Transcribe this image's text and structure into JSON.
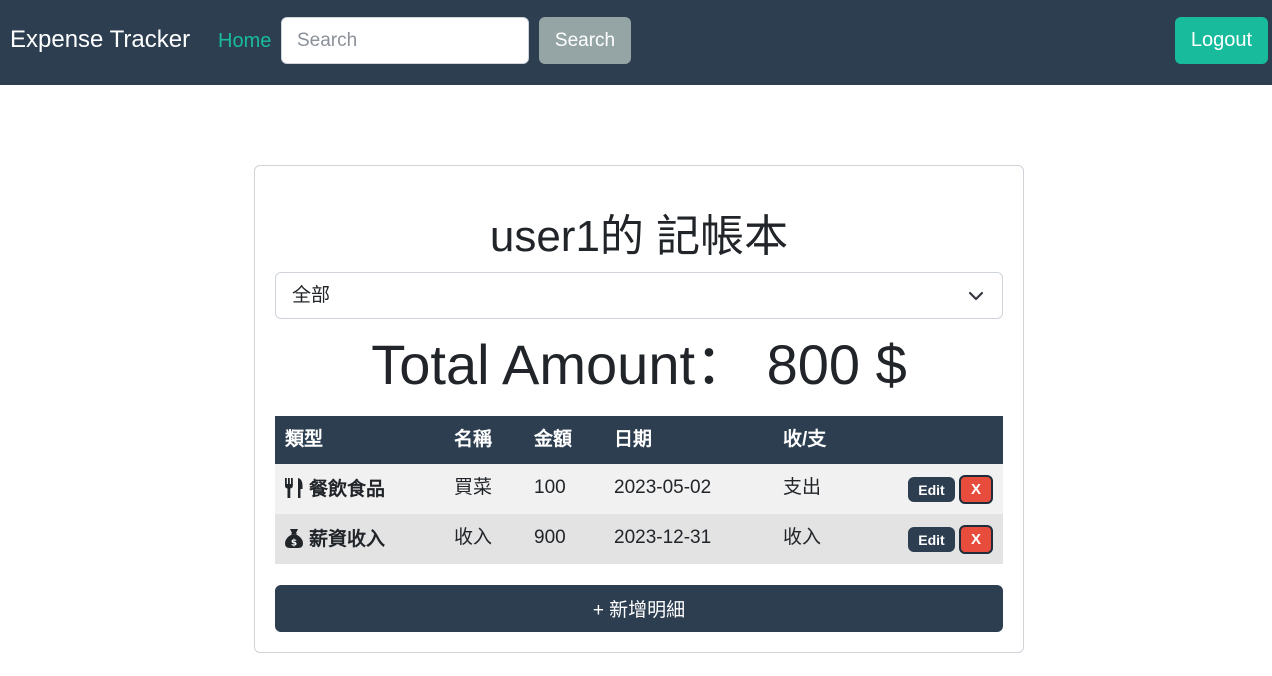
{
  "navbar": {
    "brand": "Expense Tracker",
    "home_label": "Home",
    "search_placeholder": "Search",
    "search_value": "",
    "search_button_label": "Search",
    "logout_label": "Logout"
  },
  "card": {
    "title": "user1的 記帳本",
    "category_filter": {
      "selected": "全部"
    },
    "total_amount": "Total Amount： 800 $",
    "table": {
      "headers": [
        "類型",
        "名稱",
        "金額",
        "日期",
        "收/支"
      ],
      "rows": [
        {
          "icon": "utensils-icon",
          "category": "餐飲食品",
          "name": "買菜",
          "amount": "100",
          "date": "2023-05-02",
          "type": "支出",
          "edit_label": "Edit",
          "delete_label": "X"
        },
        {
          "icon": "money-bag-icon",
          "category": "薪資收入",
          "name": "收入",
          "amount": "900",
          "date": "2023-12-31",
          "type": "收入",
          "edit_label": "Edit",
          "delete_label": "X"
        }
      ]
    },
    "add_button_label": "+ 新增明細"
  },
  "colors": {
    "navbar_bg": "#2c3e50",
    "accent": "#18bc9c",
    "secondary": "#95a5a6",
    "danger": "#e74c3c"
  }
}
